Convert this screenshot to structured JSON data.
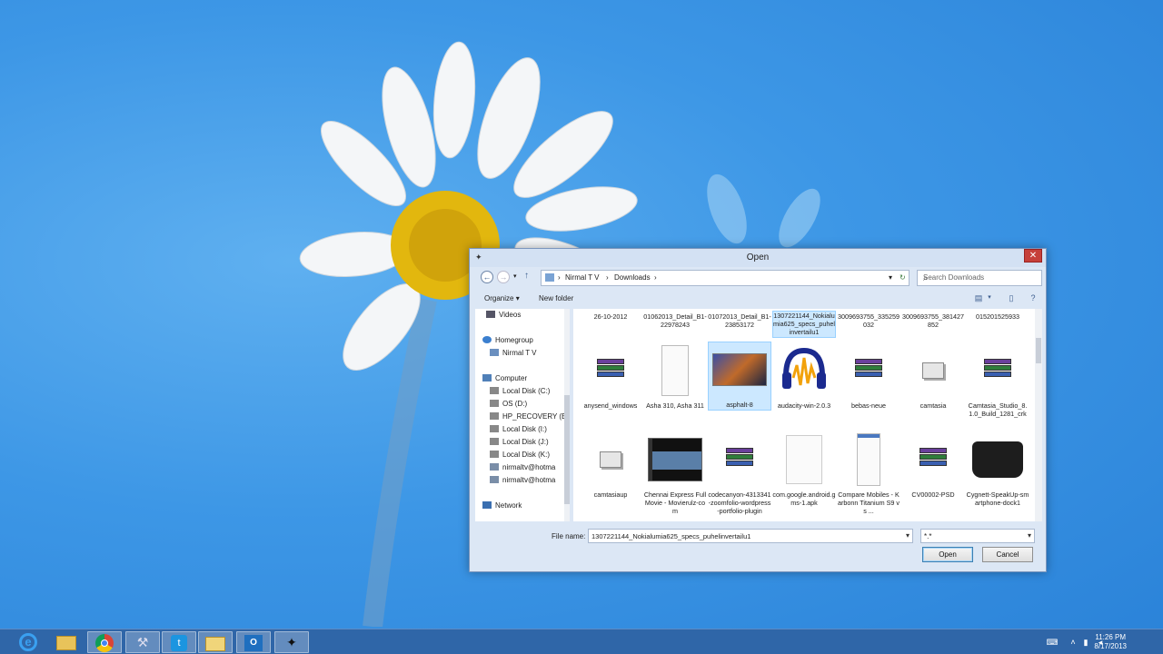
{
  "dialog": {
    "title": "Open",
    "breadcrumb": [
      "Nirmal T V",
      "Downloads"
    ],
    "search_placeholder": "Search Downloads",
    "toolbar": {
      "organize": "Organize",
      "new_folder": "New folder"
    },
    "nav": {
      "videos": "Videos",
      "homegroup": "Homegroup",
      "homegroup_user": "Nirmal T V",
      "computer": "Computer",
      "drives": [
        "Local Disk (C:)",
        "OS (D:)",
        "HP_RECOVERY (E",
        "Local Disk (I:)",
        "Local Disk (J:)",
        "Local Disk (K:)",
        "nirmaltv@hotma",
        "nirmaltv@hotma"
      ],
      "network": "Network"
    },
    "files": {
      "row0": [
        "26-10-2012",
        "01062013_Detail_B1-22978243",
        "01072013_Detail_B1-23853172",
        "1307221144_Nokialumia625_specs_puhelinvertailu1",
        "3009693755_335259032",
        "3009693755_381427852",
        "015201525933"
      ],
      "row1": [
        "anysend_windows",
        "Asha 310, Asha 311",
        "asphalt-8",
        "audacity-win-2.0.3",
        "bebas-neue",
        "camtasia",
        "Camtasia_Studio_8.1.0_Build_1281_crk"
      ],
      "row2": [
        "camtasiaup",
        "Chennai Express Full Movie - Movierulz-com",
        "codecanyon-4313341-zoomfolio-wordpress-portfolio-plugin",
        "com.google.android.gms-1.apk",
        "Compare Mobiles - Karbonn Titanium S9 vs ...",
        "CV00002-PSD",
        "Cygnett-SpeakUp-smartphone-dock1"
      ]
    },
    "file_name_label": "File name:",
    "file_name_value": "1307221144_Nokialumia625_specs_puhelinvertailu1",
    "filter_value": "*.*",
    "open_button": "Open",
    "cancel_button": "Cancel"
  },
  "taskbar": {
    "apps": [
      "internet-explorer-icon",
      "file-explorer-icon",
      "chrome-icon",
      "tool-icon",
      "twitter-icon",
      "folder-icon",
      "outlook-icon",
      "pin-icon"
    ],
    "time": "11:26 PM",
    "date": "8/17/2013"
  },
  "colors": {
    "desktop": "#3d97e6",
    "taskbar": "#2f66a8",
    "selection": "#cce8ff"
  }
}
